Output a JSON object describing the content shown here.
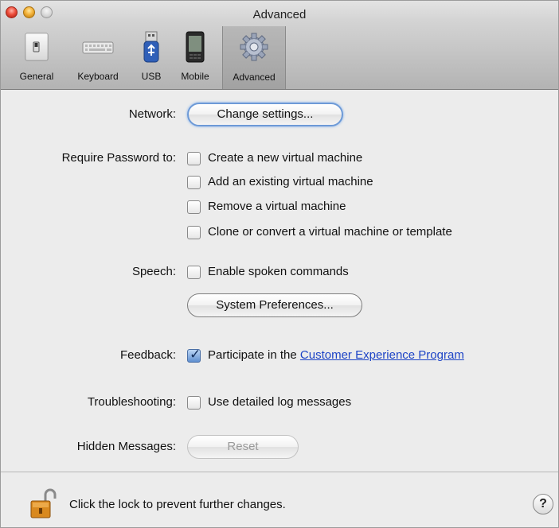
{
  "window": {
    "title": "Advanced"
  },
  "toolbar": {
    "items": [
      {
        "label": "General",
        "icon": "general-switch-icon"
      },
      {
        "label": "Keyboard",
        "icon": "keyboard-icon"
      },
      {
        "label": "USB",
        "icon": "usb-icon"
      },
      {
        "label": "Mobile",
        "icon": "mobile-phone-icon"
      },
      {
        "label": "Advanced",
        "icon": "gear-icon",
        "selected": true
      }
    ]
  },
  "network": {
    "label": "Network:",
    "button": "Change settings..."
  },
  "password": {
    "label": "Require Password to:",
    "options": [
      {
        "label": "Create a new virtual machine",
        "checked": false
      },
      {
        "label": "Add an existing virtual machine",
        "checked": false
      },
      {
        "label": "Remove a virtual machine",
        "checked": false
      },
      {
        "label": "Clone or convert a virtual machine or template",
        "checked": false
      }
    ]
  },
  "speech": {
    "label": "Speech:",
    "option": "Enable spoken commands",
    "checked": false,
    "button": "System Preferences..."
  },
  "feedback": {
    "label": "Feedback:",
    "prefix": "Participate in the ",
    "link": "Customer Experience Program",
    "checked": true
  },
  "troubleshooting": {
    "label": "Troubleshooting:",
    "option": "Use detailed log messages",
    "checked": false
  },
  "hidden_messages": {
    "label": "Hidden Messages:",
    "button": "Reset",
    "enabled": false
  },
  "footer": {
    "lock_text": "Click the lock to prevent further changes.",
    "help": "?"
  },
  "colors": {
    "link": "#1d44c6",
    "focus_ring": "#6d9ad7",
    "checkbox_checked": "#5f8fd0"
  }
}
